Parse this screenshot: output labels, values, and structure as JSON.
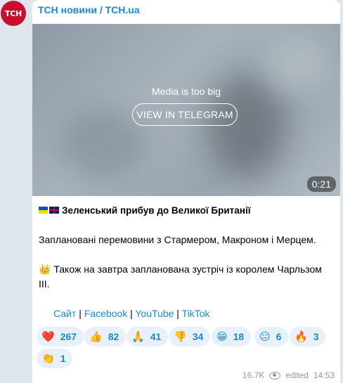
{
  "channel": {
    "avatar_text": "ТСН",
    "name": "ТСН новини / TCH.ua"
  },
  "media": {
    "notice": "Media is too big",
    "button_label": "VIEW IN TELEGRAM",
    "duration": "0:21"
  },
  "post": {
    "headline": "Зеленський прибув до Великої Британії",
    "line1": "Заплановані перемовини з Стармером, Макроном і Мерцем.",
    "crown": "👑",
    "line2": "Також на завтра запланована зустріч із королем Чарльзом III."
  },
  "links": {
    "site": "Сайт",
    "facebook": "Facebook",
    "youtube": "YouTube",
    "tiktok": "TikTok",
    "separator": "|"
  },
  "reactions": [
    {
      "emoji": "❤️",
      "count": "267"
    },
    {
      "emoji": "👍",
      "count": "82"
    },
    {
      "emoji": "🙏",
      "count": "41"
    },
    {
      "emoji": "👎",
      "count": "34"
    },
    {
      "emoji": "😁",
      "count": "18"
    },
    {
      "emoji": "😐",
      "count": "6"
    },
    {
      "emoji": "🔥",
      "count": "3"
    },
    {
      "emoji": "👏",
      "count": "1"
    }
  ],
  "meta": {
    "views": "16.7K",
    "edited_label": "edited",
    "time": "14:53"
  },
  "colors": {
    "accent": "#168acd",
    "avatar": "#c8102e",
    "background": "#dfe6ec"
  }
}
